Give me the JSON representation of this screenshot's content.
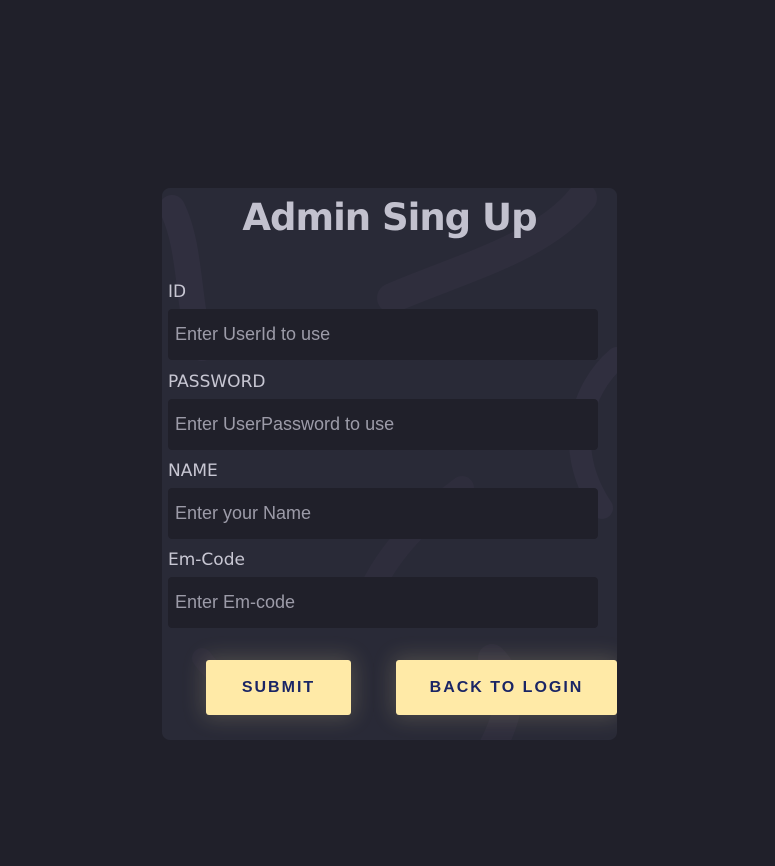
{
  "form": {
    "title": "Admin Sing Up",
    "fields": [
      {
        "label": "ID",
        "placeholder": "Enter UserId to use",
        "value": ""
      },
      {
        "label": "PASSWORD",
        "placeholder": "Enter UserPassword to use",
        "value": ""
      },
      {
        "label": "NAME",
        "placeholder": "Enter your Name",
        "value": ""
      },
      {
        "label": "Em-Code",
        "placeholder": "Enter Em-code",
        "value": ""
      }
    ],
    "submit_label": "SUBMIT",
    "back_label": "BACK TO LOGIN"
  },
  "colors": {
    "page_background": "#20202a",
    "card_background": "#292a37",
    "input_background": "#20202a",
    "button_background": "#ffeaa7",
    "button_text": "#1a2565",
    "title_text": "#c2c1ce"
  }
}
